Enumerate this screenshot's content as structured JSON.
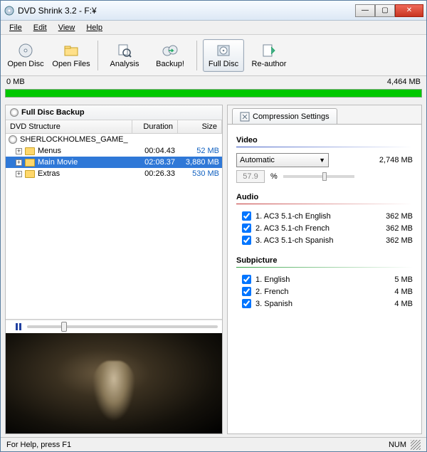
{
  "window": {
    "title": "DVD Shrink 3.2 - F:¥"
  },
  "menu": {
    "file": "File",
    "edit": "Edit",
    "view": "View",
    "help": "Help"
  },
  "toolbar": {
    "open_disc": "Open Disc",
    "open_files": "Open Files",
    "analysis": "Analysis",
    "backup": "Backup!",
    "full_disc": "Full Disc",
    "reauthor": "Re-author"
  },
  "size_readout": {
    "min": "0 MB",
    "max": "4,464 MB"
  },
  "left": {
    "header": "Full Disc Backup",
    "cols": {
      "structure": "DVD Structure",
      "duration": "Duration",
      "size": "Size"
    },
    "disc_name": "SHERLOCKHOLMES_GAME_",
    "items": [
      {
        "name": "Menus",
        "duration": "00:04.43",
        "size": "52 MB",
        "selected": false
      },
      {
        "name": "Main Movie",
        "duration": "02:08.37",
        "size": "3,880 MB",
        "selected": true
      },
      {
        "name": "Extras",
        "duration": "00:26.33",
        "size": "530 MB",
        "selected": false
      }
    ]
  },
  "playback": {
    "slider_pct": 18
  },
  "right": {
    "tab": "Compression Settings",
    "video": {
      "title": "Video",
      "mode": "Automatic",
      "pct_value": "57.9",
      "pct_sym": "%",
      "size": "2,748 MB"
    },
    "audio": {
      "title": "Audio",
      "tracks": [
        {
          "label": "1. AC3 5.1-ch English",
          "size": "362 MB",
          "checked": true
        },
        {
          "label": "2. AC3 5.1-ch French",
          "size": "362 MB",
          "checked": true
        },
        {
          "label": "3. AC3 5.1-ch Spanish",
          "size": "362 MB",
          "checked": true
        }
      ]
    },
    "subpicture": {
      "title": "Subpicture",
      "tracks": [
        {
          "label": "1. English",
          "size": "5 MB",
          "checked": true
        },
        {
          "label": "2. French",
          "size": "4 MB",
          "checked": true
        },
        {
          "label": "3. Spanish",
          "size": "4 MB",
          "checked": true
        }
      ]
    }
  },
  "status": {
    "help": "For Help, press F1",
    "num": "NUM"
  }
}
